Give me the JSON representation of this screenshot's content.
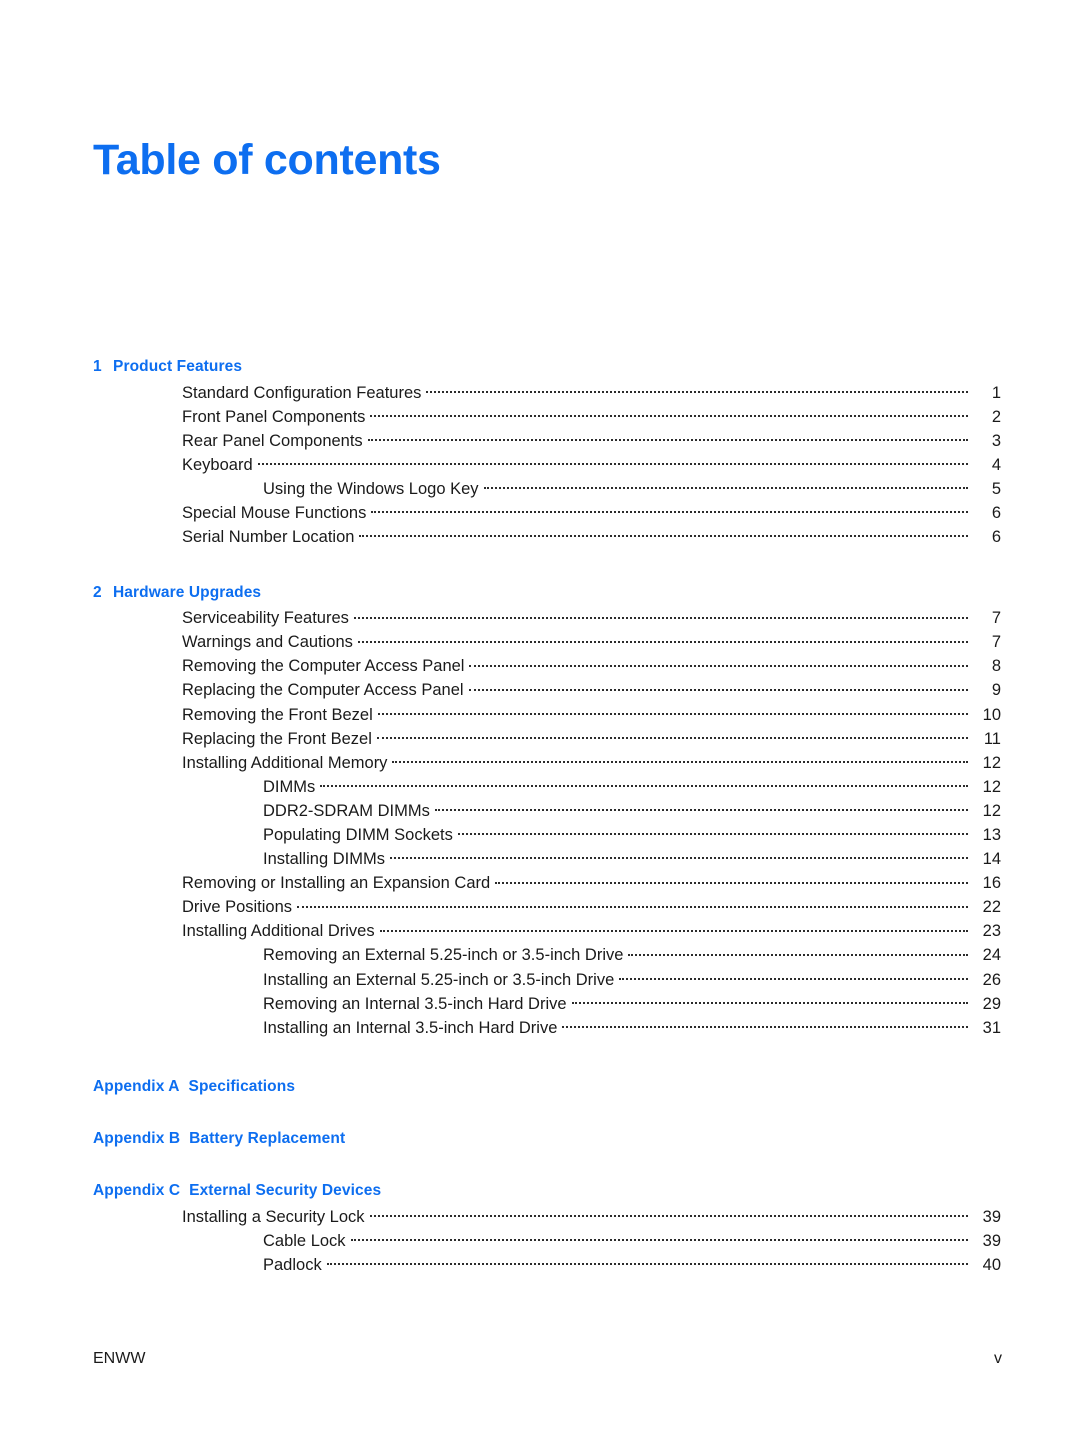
{
  "page": {
    "title": "Table of contents",
    "accent_color": "#0d6ef0",
    "text_color": "#1a1a1a",
    "background_color": "#ffffff"
  },
  "footer": {
    "left": "ENWW",
    "right": "v"
  },
  "toc": {
    "sections": [
      {
        "kind": "chapter",
        "number": "1",
        "title": "Product Features",
        "entries": [
          {
            "level": 1,
            "label": "Standard Configuration Features",
            "page": "1"
          },
          {
            "level": 1,
            "label": "Front Panel Components",
            "page": "2"
          },
          {
            "level": 1,
            "label": "Rear Panel Components",
            "page": "3"
          },
          {
            "level": 1,
            "label": "Keyboard",
            "page": "4"
          },
          {
            "level": 2,
            "label": "Using the Windows Logo Key",
            "page": "5"
          },
          {
            "level": 1,
            "label": "Special Mouse Functions",
            "page": "6"
          },
          {
            "level": 1,
            "label": "Serial Number Location",
            "page": "6"
          }
        ]
      },
      {
        "kind": "chapter",
        "number": "2",
        "title": "Hardware Upgrades",
        "entries": [
          {
            "level": 1,
            "label": "Serviceability Features",
            "page": "7"
          },
          {
            "level": 1,
            "label": "Warnings and Cautions",
            "page": "7"
          },
          {
            "level": 1,
            "label": "Removing the Computer Access Panel",
            "page": "8"
          },
          {
            "level": 1,
            "label": "Replacing the Computer Access Panel",
            "page": "9"
          },
          {
            "level": 1,
            "label": "Removing the Front Bezel",
            "page": "10"
          },
          {
            "level": 1,
            "label": "Replacing the Front Bezel",
            "page": "11"
          },
          {
            "level": 1,
            "label": "Installing Additional Memory",
            "page": "12"
          },
          {
            "level": 2,
            "label": "DIMMs",
            "page": "12"
          },
          {
            "level": 2,
            "label": "DDR2-SDRAM DIMMs",
            "page": "12"
          },
          {
            "level": 2,
            "label": "Populating DIMM Sockets",
            "page": "13"
          },
          {
            "level": 2,
            "label": "Installing DIMMs",
            "page": "14"
          },
          {
            "level": 1,
            "label": "Removing or Installing an Expansion Card",
            "page": "16"
          },
          {
            "level": 1,
            "label": "Drive Positions",
            "page": "22"
          },
          {
            "level": 1,
            "label": "Installing Additional Drives",
            "page": "23"
          },
          {
            "level": 2,
            "label": "Removing an External 5.25-inch or 3.5-inch Drive",
            "page": "24"
          },
          {
            "level": 2,
            "label": "Installing an External 5.25-inch or 3.5-inch Drive",
            "page": "26"
          },
          {
            "level": 2,
            "label": "Removing an Internal 3.5-inch Hard Drive",
            "page": "29"
          },
          {
            "level": 2,
            "label": "Installing an Internal 3.5-inch Hard Drive",
            "page": "31"
          }
        ]
      },
      {
        "kind": "appendix",
        "number": "Appendix A",
        "title": "Specifications",
        "entries": []
      },
      {
        "kind": "appendix",
        "number": "Appendix B",
        "title": "Battery Replacement",
        "entries": []
      },
      {
        "kind": "appendix",
        "number": "Appendix C",
        "title": "External Security Devices",
        "entries": [
          {
            "level": 1,
            "label": "Installing a Security Lock",
            "page": "39"
          },
          {
            "level": 2,
            "label": "Cable Lock",
            "page": "39"
          },
          {
            "level": 2,
            "label": "Padlock",
            "page": "40"
          }
        ]
      }
    ]
  }
}
